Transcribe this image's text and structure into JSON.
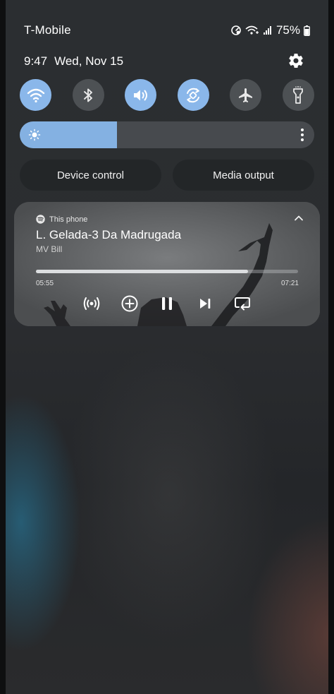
{
  "status_bar": {
    "carrier": "T-Mobile",
    "battery": "75%"
  },
  "header": {
    "time": "9:47",
    "date": "Wed, Nov 15"
  },
  "quick_toggles": [
    {
      "name": "wifi",
      "icon": "wifi-icon",
      "on": true
    },
    {
      "name": "bluetooth",
      "icon": "bluetooth-icon",
      "on": false
    },
    {
      "name": "sound",
      "icon": "volume-icon",
      "on": true
    },
    {
      "name": "auto-rotate",
      "icon": "rotate-icon",
      "on": true
    },
    {
      "name": "airplane",
      "icon": "airplane-icon",
      "on": false
    },
    {
      "name": "flashlight",
      "icon": "flashlight-icon",
      "on": false
    }
  ],
  "brightness": {
    "level": 0.33
  },
  "buttons": {
    "device_control": "Device control",
    "media_output": "Media output"
  },
  "media": {
    "source": "This phone",
    "title": "L. Gelada-3 Da Madrugada",
    "artist": "MV Bill",
    "elapsed": "05:55",
    "total": "07:21",
    "progress": 0.81
  },
  "colors": {
    "toggle_on": "#8ab7ea",
    "brightness_fill": "#84b1e2"
  }
}
